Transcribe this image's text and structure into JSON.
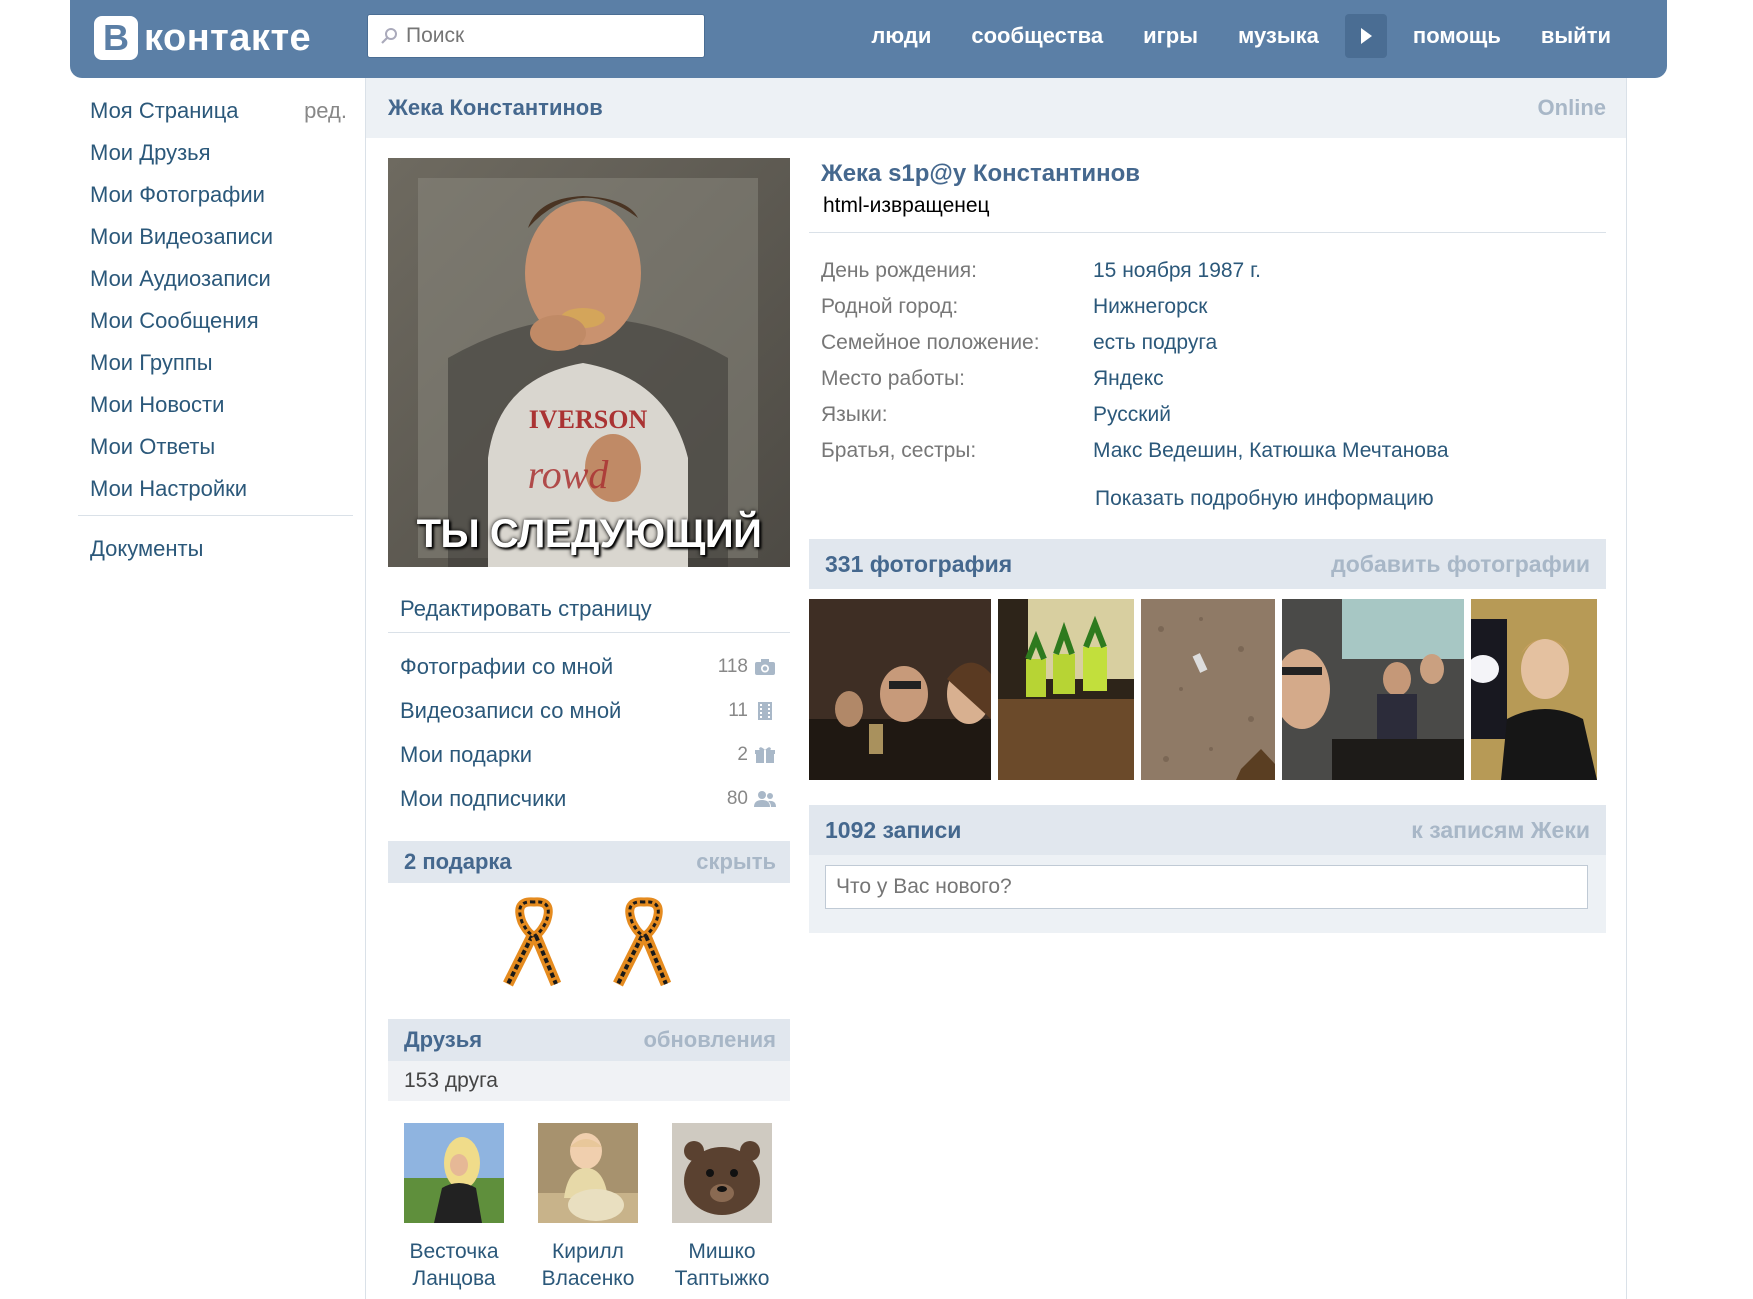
{
  "header": {
    "logo_letter": "В",
    "logo_text": "контакте",
    "search_placeholder": "Поиск",
    "nav": [
      "люди",
      "сообщества",
      "игры",
      "музыка",
      "помощь",
      "выйти"
    ]
  },
  "sidebar": {
    "items": [
      {
        "label": "Моя Страница",
        "extra": "ред."
      },
      {
        "label": "Мои Друзья"
      },
      {
        "label": "Мои Фотографии"
      },
      {
        "label": "Мои Видеозаписи"
      },
      {
        "label": "Мои Аудиозаписи"
      },
      {
        "label": "Мои Сообщения"
      },
      {
        "label": "Мои Группы"
      },
      {
        "label": "Мои Новости"
      },
      {
        "label": "Мои Ответы"
      },
      {
        "label": "Мои Настройки"
      }
    ],
    "documents": "Документы"
  },
  "page": {
    "name": "Жека Константинов",
    "online": "Online"
  },
  "profile": {
    "avatar_caption": "ТЫ СЛЕДУЮЩИЙ",
    "edit_link": "Редактировать страницу",
    "stats": [
      {
        "label": "Фотографии со мной",
        "count": "118",
        "icon": "camera-icon"
      },
      {
        "label": "Видеозаписи со мной",
        "count": "11",
        "icon": "film-icon"
      },
      {
        "label": "Мои подарки",
        "count": "2",
        "icon": "gift-icon"
      },
      {
        "label": "Мои подписчики",
        "count": "80",
        "icon": "users-icon"
      }
    ],
    "gifts": {
      "title": "2 подарка",
      "action": "скрыть"
    },
    "friends": {
      "title": "Друзья",
      "action": "обновления",
      "count": "153 друга",
      "list": [
        {
          "first": "Весточка",
          "last": "Ланцова"
        },
        {
          "first": "Кирилл",
          "last": "Власенко"
        },
        {
          "first": "Мишко",
          "last": "Таптыжко"
        }
      ]
    }
  },
  "info": {
    "full_name": "Жека s1p@y Константинов",
    "status": "html-извращенец",
    "rows": [
      {
        "label": "День рождения:",
        "value": "15 ноября 1987 г."
      },
      {
        "label": "Родной город:",
        "value": "Нижнегорск"
      },
      {
        "label": "Семейное положение:",
        "value": "есть подруга"
      },
      {
        "label": "Место работы:",
        "value": "Яндекс"
      },
      {
        "label": "Языки:",
        "value": "Русский"
      },
      {
        "label": "Братья, сестры:",
        "value": "Макс Ведешин, Катюшка Мечтанова"
      }
    ],
    "show_more": "Показать подробную информацию"
  },
  "photos": {
    "title": "331 фотография",
    "action": "добавить фотографии"
  },
  "wall": {
    "title": "1092 записи",
    "action": "к записям Жеки",
    "placeholder": "Что у Вас нового?"
  },
  "colors": {
    "brand": "#5b7fa6",
    "link": "#2b587a",
    "head": "#45688e",
    "muted": "#a8b7c7"
  }
}
